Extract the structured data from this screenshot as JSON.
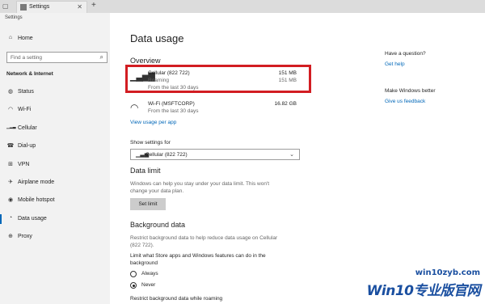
{
  "window": {
    "tab_title": "Settings",
    "app_title": "Settings",
    "new_tab_glyph": "+",
    "close_glyph": "✕"
  },
  "sidebar": {
    "home_label": "Home",
    "search_placeholder": "Find a setting",
    "section_label": "Network & Internet",
    "items": [
      {
        "label": "Status",
        "icon": "status-icon",
        "glyph": "◍"
      },
      {
        "label": "Wi-Fi",
        "icon": "wifi-icon",
        "glyph": "◠"
      },
      {
        "label": "Cellular",
        "icon": "cellular-icon",
        "glyph": "▁▂▃"
      },
      {
        "label": "Dial-up",
        "icon": "dialup-icon",
        "glyph": "☎"
      },
      {
        "label": "VPN",
        "icon": "vpn-icon",
        "glyph": "⊞"
      },
      {
        "label": "Airplane mode",
        "icon": "airplane-icon",
        "glyph": "✈"
      },
      {
        "label": "Mobile hotspot",
        "icon": "hotspot-icon",
        "glyph": "◉"
      },
      {
        "label": "Data usage",
        "icon": "data-usage-icon",
        "glyph": "◔",
        "active": true
      },
      {
        "label": "Proxy",
        "icon": "proxy-icon",
        "glyph": "⊕"
      }
    ]
  },
  "main": {
    "title": "Data usage",
    "overview_heading": "Overview",
    "cellular": {
      "name": "Cellular (822 722)",
      "usage": "151 MB",
      "roaming_label": "Roaming",
      "roaming_usage": "151 MB",
      "period": "From the last 30 days"
    },
    "wifi": {
      "name": "Wi-Fi (MSFTCORP)",
      "usage": "16.82 GB",
      "period": "From the last 30 days"
    },
    "view_usage_link": "View usage per app",
    "show_settings_label": "Show settings for",
    "show_settings_value": "Cellular (822 722)",
    "data_limit_heading": "Data limit",
    "data_limit_text_1": "Windows can help you stay under your data limit. This won't",
    "data_limit_text_2": "change your data plan.",
    "set_limit_button": "Set limit",
    "background_heading": "Background data",
    "background_text_1": "Restrict background data to help reduce data usage on Cellular",
    "background_text_2": "(822 722).",
    "limit_question_1": "Limit what Store apps and Windows features can do in the",
    "limit_question_2": "background",
    "option_always": "Always",
    "option_never": "Never",
    "selected_option": "Never",
    "roaming_restrict_label": "Restrict background data while roaming"
  },
  "right_column": {
    "question_heading": "Have a question?",
    "help_link": "Get help",
    "better_heading": "Make Windows better",
    "feedback_link": "Give us feedback"
  },
  "watermark": {
    "site": "win10zyb.com",
    "brand": "Win10专业版官网"
  },
  "colors": {
    "accent": "#0067b8",
    "highlight_border": "#d21d22",
    "sidebar_bg": "#f2f2f2",
    "watermark": "#1a4fa0"
  }
}
